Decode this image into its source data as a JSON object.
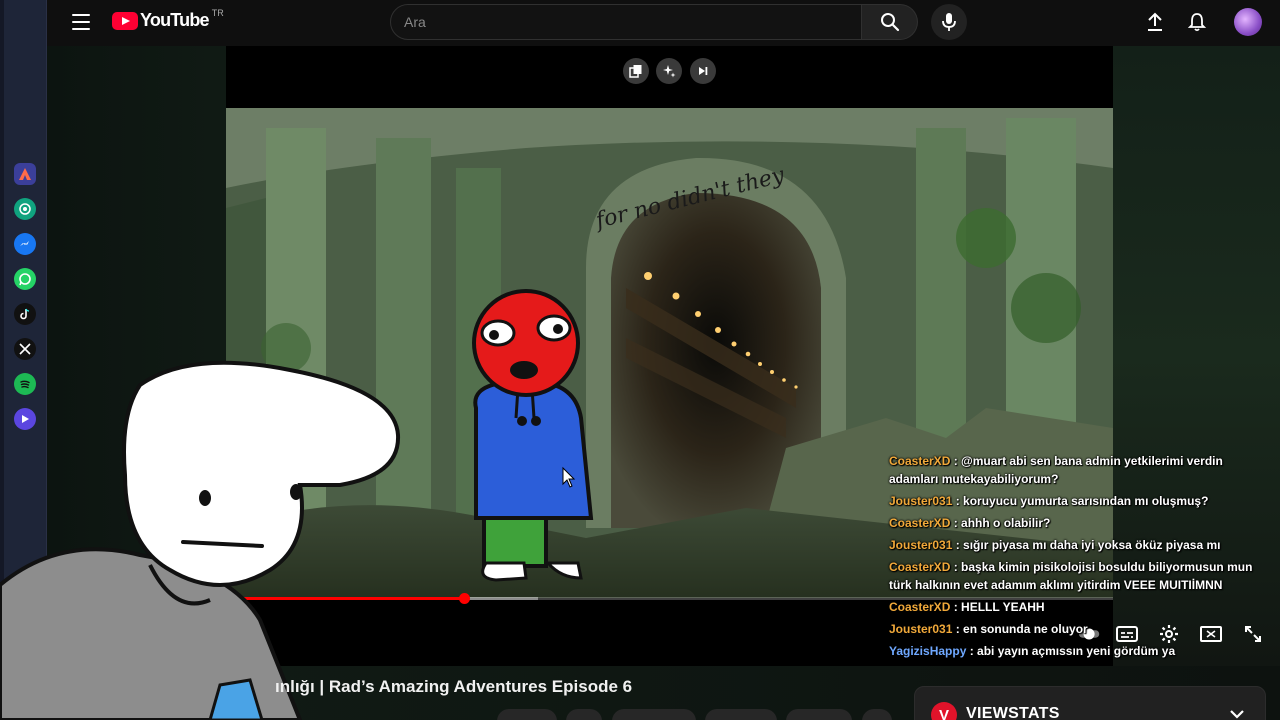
{
  "dock": {
    "apps": [
      {
        "name": "app-launcher-icon",
        "color": "#e9483b"
      },
      {
        "name": "chatgpt-icon",
        "color": "#10a37f"
      },
      {
        "name": "messenger-icon",
        "color": "#1877f2"
      },
      {
        "name": "whatsapp-icon",
        "color": "#25d366"
      },
      {
        "name": "tiktok-icon",
        "color": "#111111"
      },
      {
        "name": "x-icon",
        "color": "#111111"
      },
      {
        "name": "spotify-icon",
        "color": "#1db954"
      },
      {
        "name": "video-app-icon",
        "color": "#5b46e0"
      }
    ]
  },
  "header": {
    "logo_text": "YouTube",
    "region": "TR",
    "search_placeholder": "Ara"
  },
  "player": {
    "progress_fraction": 0.268,
    "buffer_fraction": 0.352,
    "scene_text": "for no didn't they"
  },
  "chat": [
    {
      "user": "CoasterXD",
      "color": "#f1a93a",
      "message": "@muart abi sen bana admin yetkilerimi verdin adamları mutekayabiliyorum?"
    },
    {
      "user": "Jouster031",
      "color": "#f1a93a",
      "message": "koruyucu yumurta sarısından mı oluşmuş?"
    },
    {
      "user": "CoasterXD",
      "color": "#f1a93a",
      "message": "ahhh o olabilir?"
    },
    {
      "user": "Jouster031",
      "color": "#f1a93a",
      "message": "sığır piyasa mı daha iyi yoksa öküz piyasa mı"
    },
    {
      "user": "CoasterXD",
      "color": "#f1a93a",
      "message": "başka kimin pisikolojisi bosuldu biliyormusun mun türk halkının evet adamım aklımı yitirdim VEEE MUITIİMNN"
    },
    {
      "user": "CoasterXD",
      "color": "#f1a93a",
      "message": "HELLL YEAHH"
    },
    {
      "user": "Jouster031",
      "color": "#f1a93a",
      "message": "en sonunda ne oluyor"
    },
    {
      "user": "YagizisHappy",
      "color": "#6fa8ff",
      "message": "abi yayın açmıssın yeni gördüm ya"
    }
  ],
  "video": {
    "title": "ınlığı | Rad’s Amazing Adventures Episode 6"
  },
  "viewstats": {
    "logo": "V",
    "name": "VIEWSTATS"
  }
}
